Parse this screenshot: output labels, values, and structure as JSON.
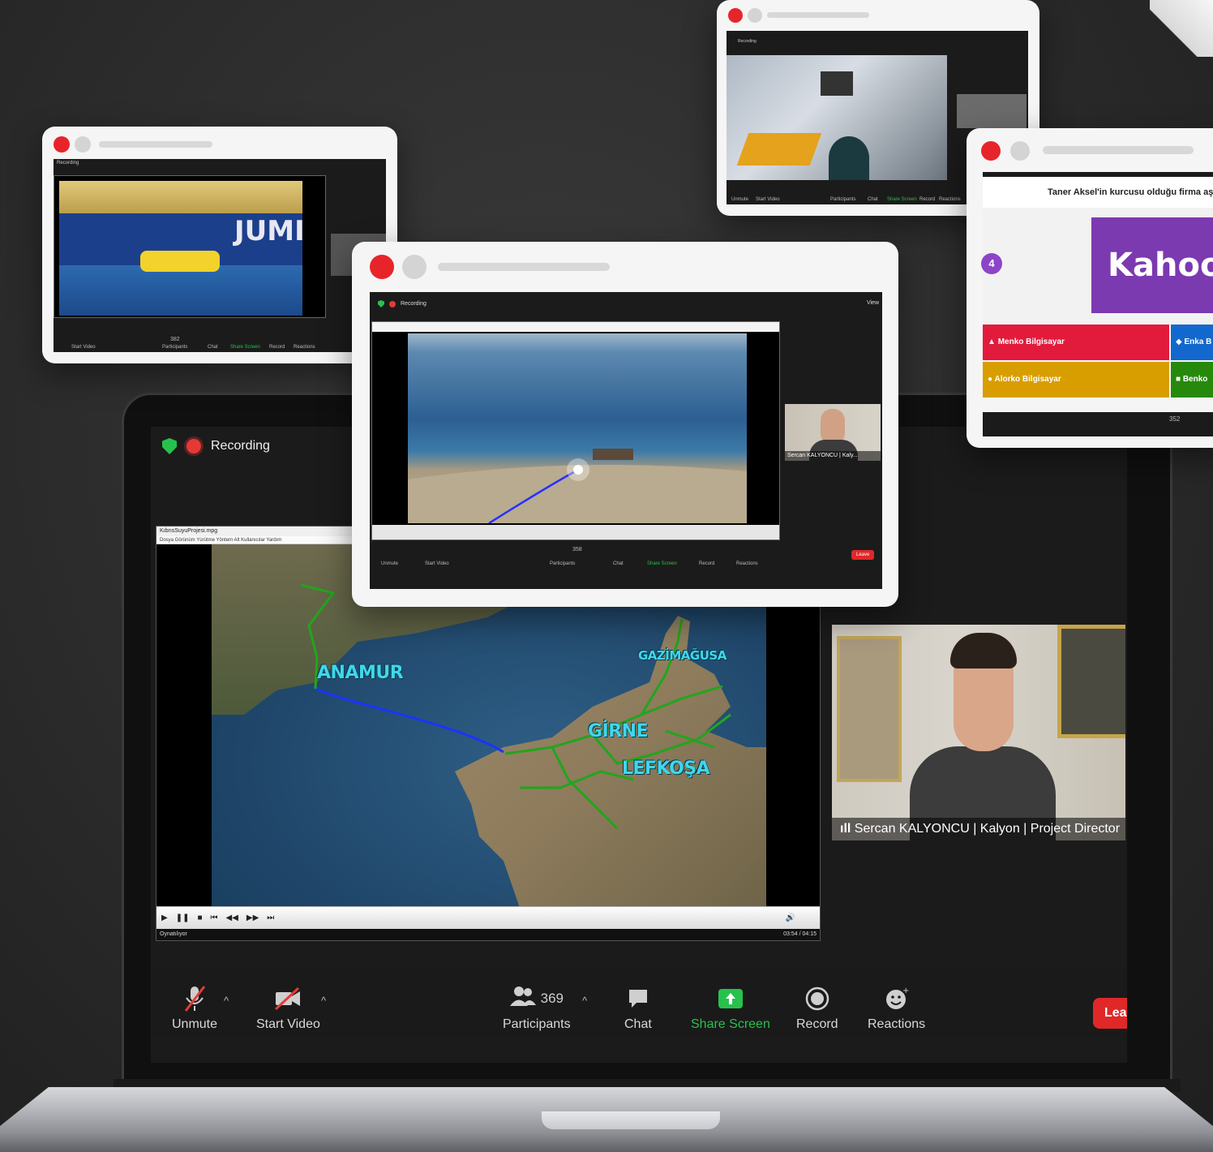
{
  "main_meeting": {
    "recording_label": "Recording",
    "player": {
      "title": "KıbrısSuyuProjesi.mpg",
      "menu": "Dosya  Görünüm  Yürütme  Yöntem  Alt Kullanıcılar  Yardım",
      "status_left": "Oynatılıyor",
      "status_right": "03:54 / 04:15"
    },
    "map_labels": {
      "anamur": "ANAMUR",
      "gazimagusa": "GAZİMAĞUSA",
      "girne": "GİRNE",
      "lefkosa": "LEFKOŞA"
    },
    "speaker_name": "Sercan KALYONCU | Kalyon | Project Director",
    "toolbar": {
      "unmute": "Unmute",
      "start_video": "Start Video",
      "participants": "Participants",
      "participants_count": "369",
      "chat": "Chat",
      "share_screen": "Share Screen",
      "record": "Record",
      "reactions": "Reactions",
      "leave": "Lea"
    }
  },
  "center_card": {
    "recording_label": "Recording",
    "view_label": "View",
    "speaker_name": "Sercan KALYONCU | Kaly...",
    "toolbar": {
      "unmute": "Unmute",
      "start_video": "Start Video",
      "participants": "Participants",
      "participants_count": "358",
      "chat": "Chat",
      "share_screen": "Share Screen",
      "record": "Record",
      "reactions": "Reactions",
      "leave": "Leave"
    }
  },
  "left_card": {
    "recording_label": "Recording",
    "ship_text": "JUMI",
    "toolbar": {
      "start_video": "Start Video",
      "participants": "Participants",
      "participants_count": "382",
      "chat": "Chat",
      "share_screen": "Share Screen",
      "record": "Record",
      "reactions": "Reactions"
    }
  },
  "top_card": {
    "recording_label": "Recording",
    "toolbar": {
      "unmute": "Unmute",
      "start_video": "Start Video",
      "participants": "Participants",
      "chat": "Chat",
      "share_screen": "Share Screen",
      "record": "Record",
      "reactions": "Reactions"
    }
  },
  "kahoot_card": {
    "question": "Taner Aksel'in kurcusu olduğu firma aşağı",
    "logo": "Kahoo",
    "counter": "4",
    "answers": [
      {
        "text": "Menko Bilgisayar",
        "color": "#e21b3c",
        "symbol": "▲"
      },
      {
        "text": "Enka B",
        "color": "#1368ce",
        "symbol": "◆"
      },
      {
        "text": "Alorko Bilgisayar",
        "color": "#d89e00",
        "symbol": "●"
      },
      {
        "text": "Benko",
        "color": "#26890c",
        "symbol": "■"
      }
    ],
    "participants_count": "352"
  },
  "colors": {
    "accent_red": "#e8242b",
    "zoom_green": "#27c24c",
    "map_label": "#3fd7ec"
  }
}
